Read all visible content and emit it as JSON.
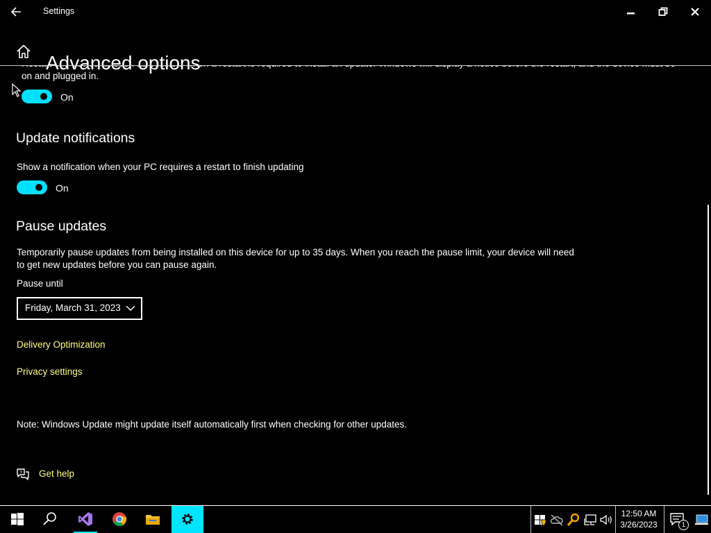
{
  "window": {
    "title": "Settings",
    "controls": [
      "minimize",
      "restore",
      "close"
    ]
  },
  "header": {
    "home_icon": "home-icon",
    "title": "Advanced options"
  },
  "content": {
    "cut_text": "Restart this device as soon as possible when a restart is required to install an update. Windows will display a notice before the restart, and the device must be on and plugged in.",
    "restart_toggle": {
      "state": "On",
      "on": true
    },
    "notifications": {
      "heading": "Update notifications",
      "description": "Show a notification when your PC requires a restart to finish updating",
      "toggle": {
        "state": "On",
        "on": true
      }
    },
    "pause": {
      "heading": "Pause updates",
      "description": "Temporarily pause updates from being installed on this device for up to 35 days. When you reach the pause limit, your device will need to get new updates before you can pause again.",
      "label": "Pause until",
      "selected": "Friday, March 31, 2023"
    },
    "links": {
      "delivery": "Delivery Optimization",
      "privacy": "Privacy settings"
    },
    "note": "Note: Windows Update might update itself automatically first when checking for other updates.",
    "help": {
      "icon": "help-chat-icon",
      "label": "Get help"
    }
  },
  "taskbar": {
    "apps": [
      {
        "icon": "windows-start-icon"
      },
      {
        "icon": "search-icon"
      },
      {
        "icon": "visual-studio-icon"
      },
      {
        "icon": "chrome-icon"
      },
      {
        "icon": "file-explorer-icon"
      },
      {
        "icon": "settings-gear-icon",
        "active": true
      }
    ],
    "tray": [
      "defender-icon",
      "cloud-off-icon",
      "search-tool-icon",
      "network-icon",
      "volume-icon"
    ],
    "clock": {
      "time": "12:50 AM",
      "date": "3/26/2023"
    },
    "notifications": {
      "icon": "action-center-icon",
      "count": "1"
    }
  },
  "colors": {
    "background": "#000000",
    "accent": "#00e5ff",
    "link": "#ffff80",
    "text": "#ffffff"
  }
}
